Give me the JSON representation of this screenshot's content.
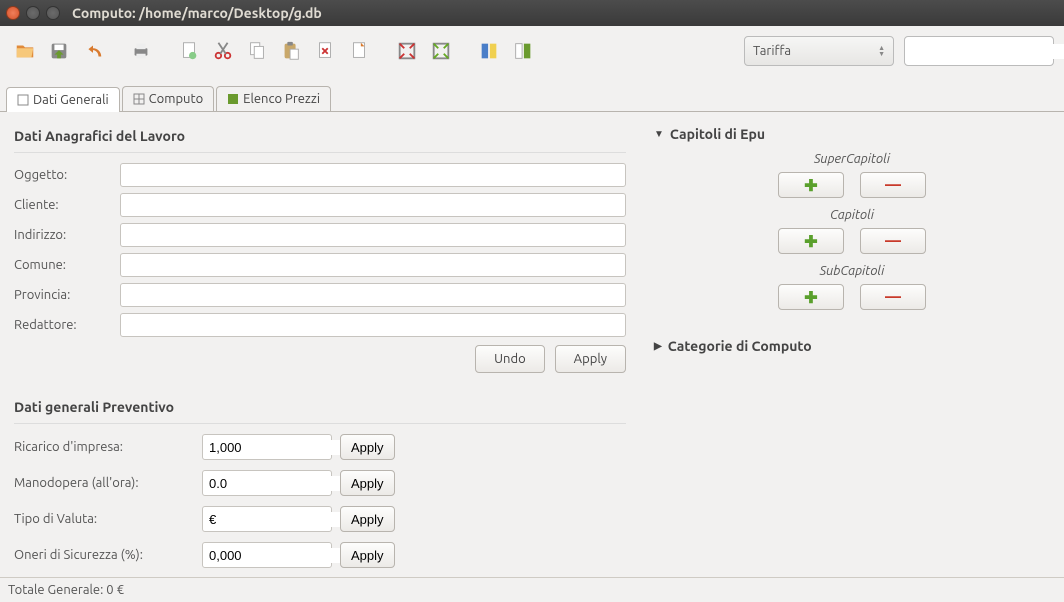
{
  "window": {
    "title": "Computo: /home/marco/Desktop/g.db"
  },
  "toolbar": {
    "combo_label": "Tariffa",
    "search_placeholder": ""
  },
  "tabs": [
    {
      "label": "Dati Generali"
    },
    {
      "label": "Computo"
    },
    {
      "label": "Elenco Prezzi"
    }
  ],
  "anagrafica": {
    "title": "Dati Anagrafici del Lavoro",
    "fields": {
      "oggetto": {
        "label": "Oggetto:",
        "value": ""
      },
      "cliente": {
        "label": "Cliente:",
        "value": ""
      },
      "indirizzo": {
        "label": "Indirizzo:",
        "value": ""
      },
      "comune": {
        "label": "Comune:",
        "value": ""
      },
      "provincia": {
        "label": "Provincia:",
        "value": ""
      },
      "redattore": {
        "label": "Redattore:",
        "value": ""
      }
    },
    "undo": "Undo",
    "apply": "Apply"
  },
  "preventivo": {
    "title": "Dati generali Preventivo",
    "rows": {
      "ricarico": {
        "label": "Ricarico d'impresa:",
        "value": "1,000",
        "apply": "Apply"
      },
      "manodopera": {
        "label": "Manodopera (all'ora):",
        "value": "0.0",
        "apply": "Apply"
      },
      "valuta": {
        "label": "Tipo di Valuta:",
        "value": "€",
        "apply": "Apply"
      },
      "oneri": {
        "label": "Oneri di Sicurezza (%):",
        "value": "0,000",
        "apply": "Apply"
      }
    }
  },
  "right": {
    "epu": {
      "title": "Capitoli di Epu",
      "super": "SuperCapitoli",
      "cap": "Capitoli",
      "sub": "SubCapitoli"
    },
    "categorie": {
      "title": "Categorie di Computo"
    }
  },
  "status": {
    "text": "Totale Generale: 0 €"
  }
}
